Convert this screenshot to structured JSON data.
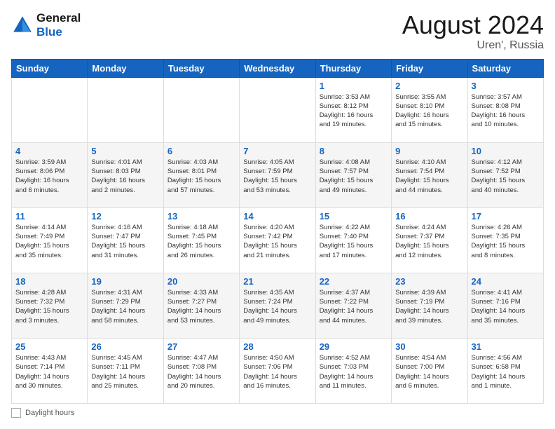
{
  "header": {
    "logo_line1": "General",
    "logo_line2": "Blue",
    "title": "August 2024",
    "subtitle": "Uren', Russia"
  },
  "days_of_week": [
    "Sunday",
    "Monday",
    "Tuesday",
    "Wednesday",
    "Thursday",
    "Friday",
    "Saturday"
  ],
  "weeks": [
    [
      {
        "day": "",
        "info": ""
      },
      {
        "day": "",
        "info": ""
      },
      {
        "day": "",
        "info": ""
      },
      {
        "day": "",
        "info": ""
      },
      {
        "day": "1",
        "info": "Sunrise: 3:53 AM\nSunset: 8:12 PM\nDaylight: 16 hours\nand 19 minutes."
      },
      {
        "day": "2",
        "info": "Sunrise: 3:55 AM\nSunset: 8:10 PM\nDaylight: 16 hours\nand 15 minutes."
      },
      {
        "day": "3",
        "info": "Sunrise: 3:57 AM\nSunset: 8:08 PM\nDaylight: 16 hours\nand 10 minutes."
      }
    ],
    [
      {
        "day": "4",
        "info": "Sunrise: 3:59 AM\nSunset: 8:06 PM\nDaylight: 16 hours\nand 6 minutes."
      },
      {
        "day": "5",
        "info": "Sunrise: 4:01 AM\nSunset: 8:03 PM\nDaylight: 16 hours\nand 2 minutes."
      },
      {
        "day": "6",
        "info": "Sunrise: 4:03 AM\nSunset: 8:01 PM\nDaylight: 15 hours\nand 57 minutes."
      },
      {
        "day": "7",
        "info": "Sunrise: 4:05 AM\nSunset: 7:59 PM\nDaylight: 15 hours\nand 53 minutes."
      },
      {
        "day": "8",
        "info": "Sunrise: 4:08 AM\nSunset: 7:57 PM\nDaylight: 15 hours\nand 49 minutes."
      },
      {
        "day": "9",
        "info": "Sunrise: 4:10 AM\nSunset: 7:54 PM\nDaylight: 15 hours\nand 44 minutes."
      },
      {
        "day": "10",
        "info": "Sunrise: 4:12 AM\nSunset: 7:52 PM\nDaylight: 15 hours\nand 40 minutes."
      }
    ],
    [
      {
        "day": "11",
        "info": "Sunrise: 4:14 AM\nSunset: 7:49 PM\nDaylight: 15 hours\nand 35 minutes."
      },
      {
        "day": "12",
        "info": "Sunrise: 4:16 AM\nSunset: 7:47 PM\nDaylight: 15 hours\nand 31 minutes."
      },
      {
        "day": "13",
        "info": "Sunrise: 4:18 AM\nSunset: 7:45 PM\nDaylight: 15 hours\nand 26 minutes."
      },
      {
        "day": "14",
        "info": "Sunrise: 4:20 AM\nSunset: 7:42 PM\nDaylight: 15 hours\nand 21 minutes."
      },
      {
        "day": "15",
        "info": "Sunrise: 4:22 AM\nSunset: 7:40 PM\nDaylight: 15 hours\nand 17 minutes."
      },
      {
        "day": "16",
        "info": "Sunrise: 4:24 AM\nSunset: 7:37 PM\nDaylight: 15 hours\nand 12 minutes."
      },
      {
        "day": "17",
        "info": "Sunrise: 4:26 AM\nSunset: 7:35 PM\nDaylight: 15 hours\nand 8 minutes."
      }
    ],
    [
      {
        "day": "18",
        "info": "Sunrise: 4:28 AM\nSunset: 7:32 PM\nDaylight: 15 hours\nand 3 minutes."
      },
      {
        "day": "19",
        "info": "Sunrise: 4:31 AM\nSunset: 7:29 PM\nDaylight: 14 hours\nand 58 minutes."
      },
      {
        "day": "20",
        "info": "Sunrise: 4:33 AM\nSunset: 7:27 PM\nDaylight: 14 hours\nand 53 minutes."
      },
      {
        "day": "21",
        "info": "Sunrise: 4:35 AM\nSunset: 7:24 PM\nDaylight: 14 hours\nand 49 minutes."
      },
      {
        "day": "22",
        "info": "Sunrise: 4:37 AM\nSunset: 7:22 PM\nDaylight: 14 hours\nand 44 minutes."
      },
      {
        "day": "23",
        "info": "Sunrise: 4:39 AM\nSunset: 7:19 PM\nDaylight: 14 hours\nand 39 minutes."
      },
      {
        "day": "24",
        "info": "Sunrise: 4:41 AM\nSunset: 7:16 PM\nDaylight: 14 hours\nand 35 minutes."
      }
    ],
    [
      {
        "day": "25",
        "info": "Sunrise: 4:43 AM\nSunset: 7:14 PM\nDaylight: 14 hours\nand 30 minutes."
      },
      {
        "day": "26",
        "info": "Sunrise: 4:45 AM\nSunset: 7:11 PM\nDaylight: 14 hours\nand 25 minutes."
      },
      {
        "day": "27",
        "info": "Sunrise: 4:47 AM\nSunset: 7:08 PM\nDaylight: 14 hours\nand 20 minutes."
      },
      {
        "day": "28",
        "info": "Sunrise: 4:50 AM\nSunset: 7:06 PM\nDaylight: 14 hours\nand 16 minutes."
      },
      {
        "day": "29",
        "info": "Sunrise: 4:52 AM\nSunset: 7:03 PM\nDaylight: 14 hours\nand 11 minutes."
      },
      {
        "day": "30",
        "info": "Sunrise: 4:54 AM\nSunset: 7:00 PM\nDaylight: 14 hours\nand 6 minutes."
      },
      {
        "day": "31",
        "info": "Sunrise: 4:56 AM\nSunset: 6:58 PM\nDaylight: 14 hours\nand 1 minute."
      }
    ]
  ],
  "footer": {
    "label": "Daylight hours"
  }
}
